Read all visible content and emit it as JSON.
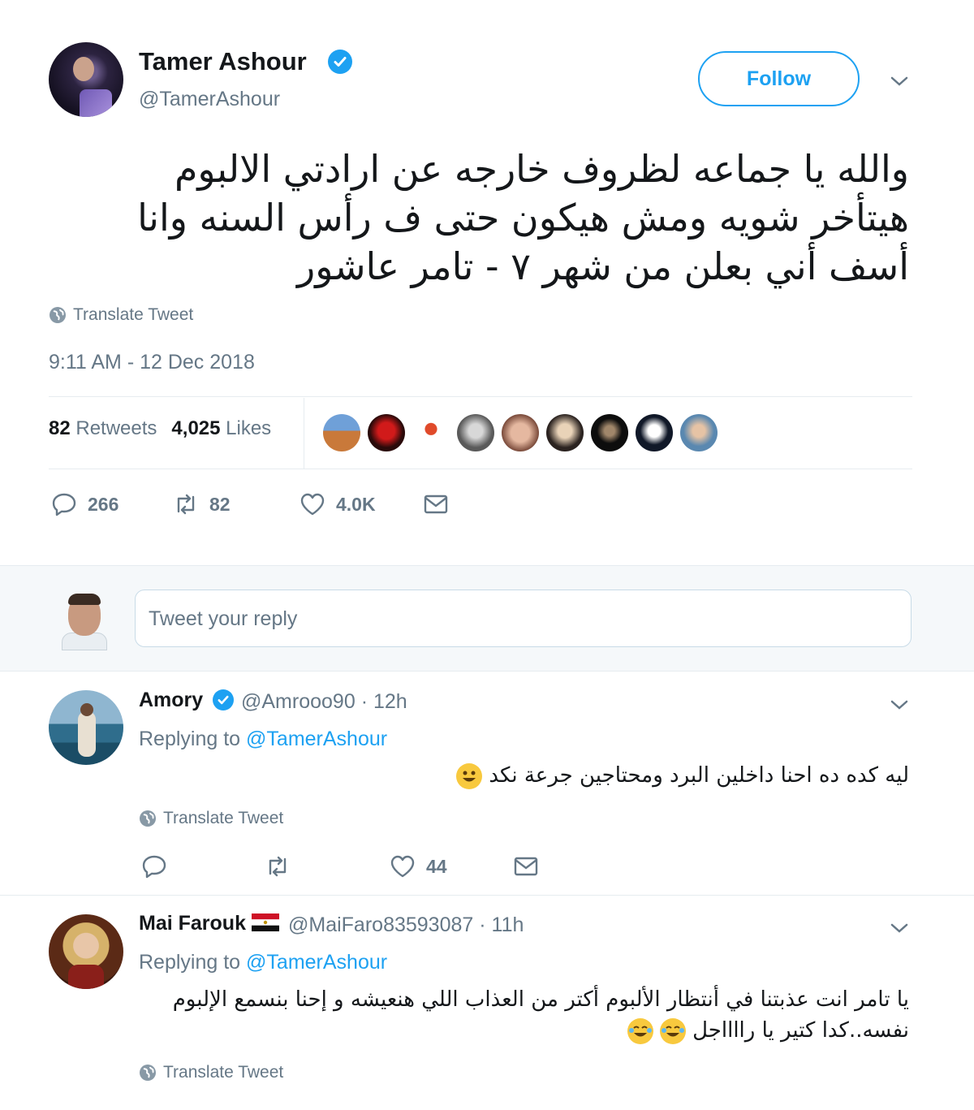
{
  "tweet": {
    "author": {
      "name": "Tamer Ashour",
      "handle": "@TamerAshour",
      "verified": true
    },
    "follow_label": "Follow",
    "text_lines": [
      "والله يا جماعه لظروف خارجه عن ارادتي الالبوم",
      "هيتأخر شويه ومش هيكون حتى ف رأس السنه وانا",
      "أسف أني بعلن من شهر ٧ - تامر عاشور"
    ],
    "translate_label": "Translate Tweet",
    "timestamp": "9:11 AM - 12 Dec 2018",
    "retweets_count": "82",
    "retweets_label": "Retweets",
    "likes_count": "4,025",
    "likes_label": "Likes",
    "actions": {
      "replies": "266",
      "retweets": "82",
      "likes": "4.0K"
    }
  },
  "reply_box": {
    "placeholder": "Tweet your reply"
  },
  "replies": [
    {
      "name": "Amory",
      "verified": true,
      "handle": "@Amrooo90",
      "time": "· 12h",
      "replying_prefix": "Replying to",
      "replying_to": "@TamerAshour",
      "text": "ليه كده ده احنا داخلين البرد ومحتاجين جرعة نكد",
      "emoji": "smiley-emoji",
      "translate_label": "Translate Tweet",
      "likes": "44"
    },
    {
      "name": "Mai Farouk",
      "flag": "egypt-flag-icon",
      "handle": "@MaiFaro83593087",
      "time": "· 11h",
      "replying_prefix": "Replying to",
      "replying_to": "@TamerAshour",
      "text_line1": "يا تامر انت عذبتنا في أنتظار الألبوم أكتر من العذاب اللي هنعيشه و إحنا بنسمع الإلبوم",
      "text_line2": "نفسه..كدا كتير يا رااااجل",
      "emoji": "tears-of-joy-emoji",
      "translate_label": "Translate Tweet"
    }
  ],
  "colors": {
    "accent": "#1da1f2",
    "muted": "#657786",
    "divider": "#e6ecf0"
  }
}
